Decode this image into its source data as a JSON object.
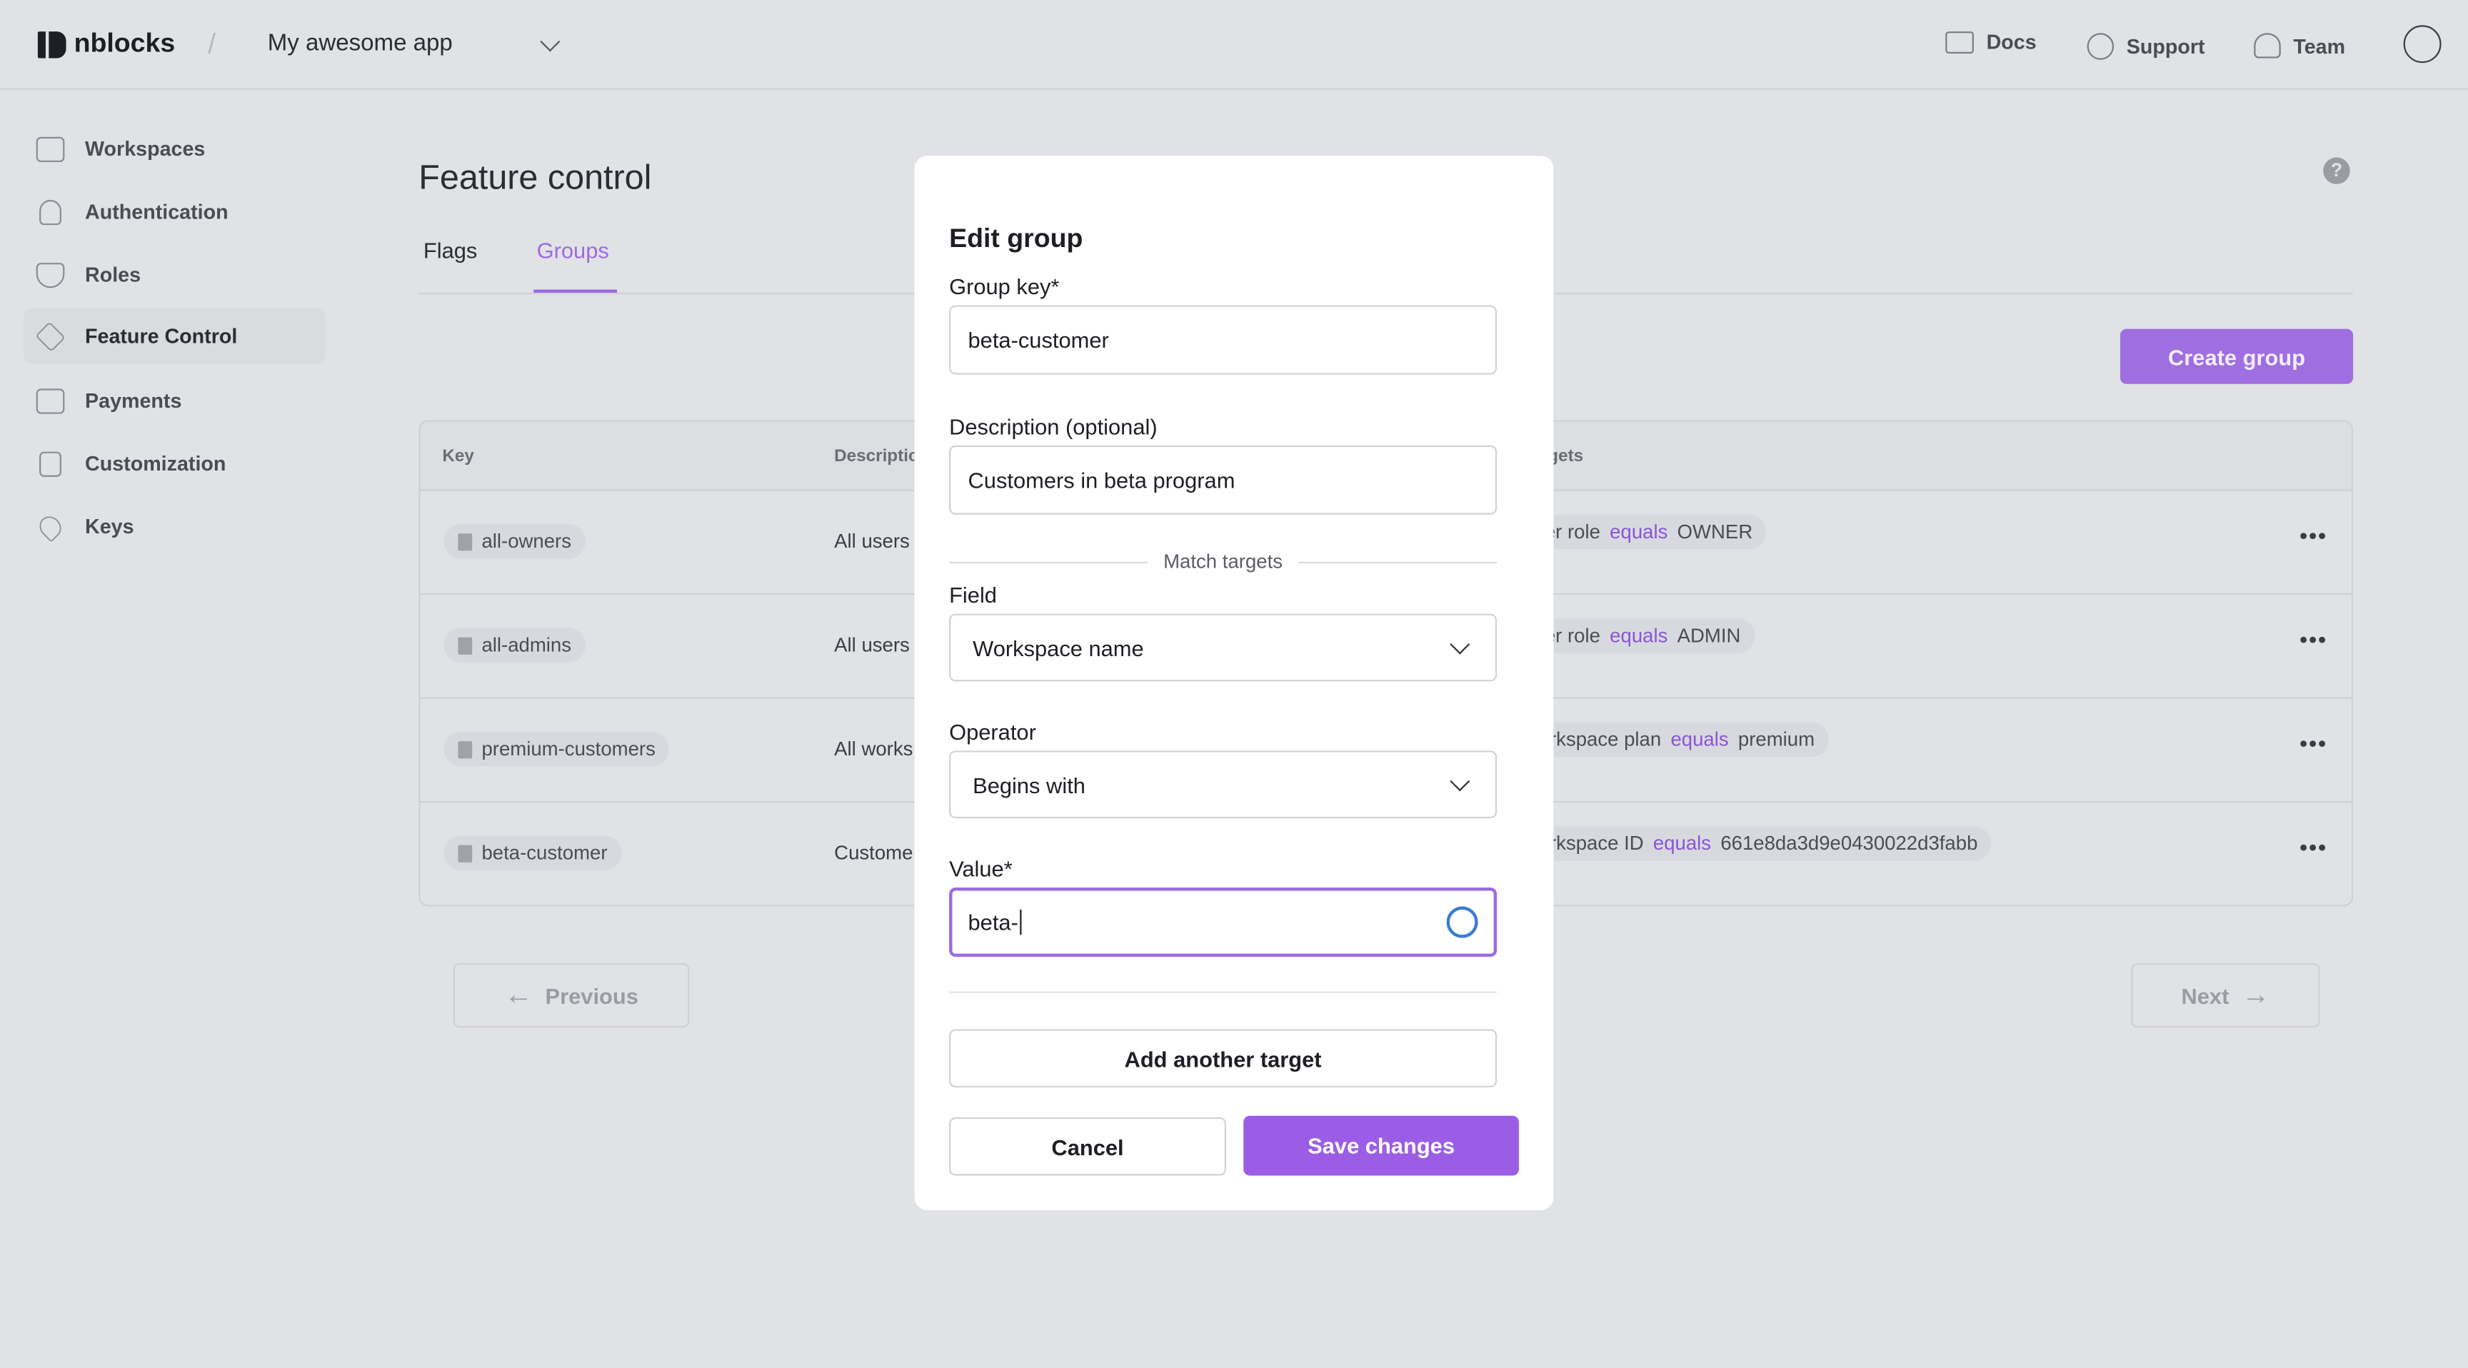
{
  "header": {
    "logo_text": "nblocks",
    "app_selector": "My awesome app",
    "links": [
      {
        "label": "Docs",
        "icon": "book-icon"
      },
      {
        "label": "Support",
        "icon": "lifebuoy-icon"
      },
      {
        "label": "Team",
        "icon": "users-icon"
      }
    ]
  },
  "sidebar": {
    "items": [
      {
        "label": "Workspaces",
        "icon": "id-card-icon"
      },
      {
        "label": "Authentication",
        "icon": "lock-icon"
      },
      {
        "label": "Roles",
        "icon": "shield-check-icon"
      },
      {
        "label": "Feature Control",
        "icon": "layers-icon",
        "active": true
      },
      {
        "label": "Payments",
        "icon": "credit-card-icon"
      },
      {
        "label": "Customization",
        "icon": "palette-icon"
      },
      {
        "label": "Keys",
        "icon": "key-icon"
      }
    ]
  },
  "main": {
    "title": "Feature control",
    "tabs": [
      {
        "label": "Flags"
      },
      {
        "label": "Groups",
        "active": true
      }
    ],
    "create_button": "Create group",
    "table": {
      "headers": [
        "Key",
        "Description",
        "Targets"
      ],
      "rows": [
        {
          "key": "all-owners",
          "description": "All users",
          "target_field": "User role",
          "target_op": "equals",
          "target_value": "OWNER"
        },
        {
          "key": "all-admins",
          "description": "All users",
          "target_field": "User role",
          "target_op": "equals",
          "target_value": "ADMIN"
        },
        {
          "key": "premium-customers",
          "description": "All works",
          "target_field": "Workspace plan",
          "target_op": "equals",
          "target_value": "premium"
        },
        {
          "key": "beta-customer",
          "description": "Custome",
          "target_field": "Workspace ID",
          "target_op": "equals",
          "target_value": "661e8da3d9e0430022d3fabb"
        }
      ]
    },
    "pagination": {
      "previous": "Previous",
      "next": "Next"
    }
  },
  "modal": {
    "title": "Edit group",
    "group_key_label": "Group key*",
    "group_key_value": "beta-customer",
    "description_label": "Description (optional)",
    "description_value": "Customers in beta program",
    "match_targets": "Match targets",
    "field_label": "Field",
    "field_value": "Workspace name",
    "operator_label": "Operator",
    "operator_value": "Begins with",
    "value_label": "Value*",
    "value_value": "beta-",
    "add_target": "Add another target",
    "cancel": "Cancel",
    "save": "Save changes"
  },
  "colors": {
    "accent": "#9b5de5",
    "background": "#e1e2e6"
  }
}
